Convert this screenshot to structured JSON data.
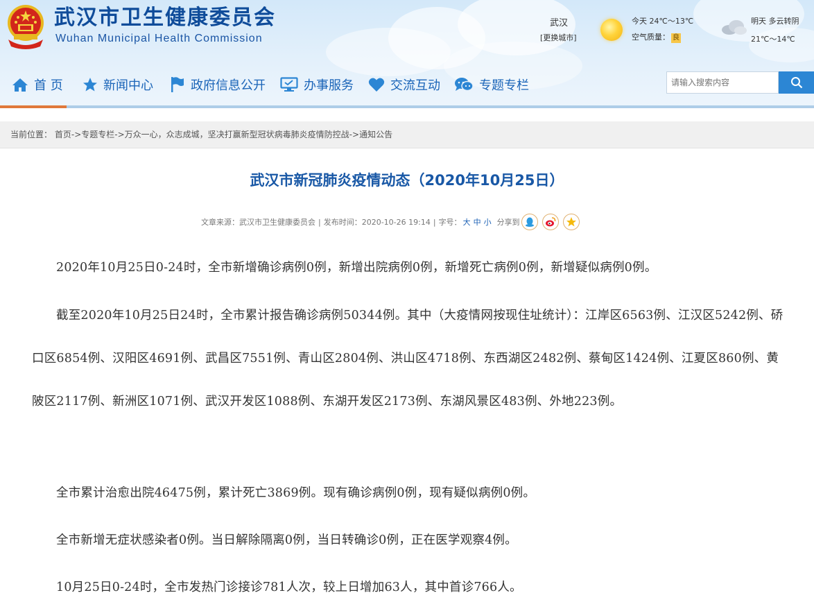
{
  "header": {
    "title_cn": "武汉市卫生健康委员会",
    "title_en": "Wuhan Municipal Health Commission"
  },
  "weather": {
    "city": "武汉",
    "change_city": "[更换城市]",
    "today": "今天 24℃～13℃",
    "aqi_label": "空气质量：",
    "aqi_value": "良",
    "tomorrow": "明天 多云转阴",
    "tomorrow_temp": "21℃～14℃",
    "icons": [
      "sun-icon",
      "cloudy-icon"
    ]
  },
  "nav": {
    "items": [
      {
        "label": "首 页",
        "icon": "home-icon"
      },
      {
        "label": "新闻中心",
        "icon": "star-icon"
      },
      {
        "label": "政府信息公开",
        "icon": "flag-icon"
      },
      {
        "label": "办事服务",
        "icon": "monitor-icon"
      },
      {
        "label": "交流互动",
        "icon": "heart-icon"
      },
      {
        "label": "专题专栏",
        "icon": "chat-icon"
      }
    ],
    "active_index": 0,
    "accent": "#e0783a"
  },
  "search": {
    "placeholder": "请输入搜索内容",
    "button_icon": "search-icon"
  },
  "breadcrumb": {
    "prefix": "当前位置：",
    "items": [
      "首页",
      "专题专栏",
      "万众一心，众志成城，坚决打赢新型冠状病毒肺炎疫情防控战",
      "通知公告"
    ],
    "separator": "->"
  },
  "article": {
    "title": "武汉市新冠肺炎疫情动态（2020年10月25日）",
    "source_label": "文章来源：",
    "source": "武汉市卫生健康委员会",
    "date_label": "发布时间：",
    "date": "2020-10-26 19:14",
    "fontsize_label": "字号：",
    "fontsize_large": "大",
    "fontsize_medium": "中",
    "fontsize_small": "小",
    "share_label": "分享到",
    "share_icons": [
      "qq-icon",
      "weibo-icon",
      "qzone-icon"
    ],
    "paragraphs": [
      "2020年10月25日0-24时，全市新增确诊病例0例，新增出院病例0例，新增死亡病例0例，新增疑似病例0例。",
      "截至2020年10月25日24时，全市累计报告确诊病例50344例。其中（大疫情网按现住址统计）：江岸区6563例、江汉区5242例、硚口区6854例、汉阳区4691例、武昌区7551例、青山区2804例、洪山区4718例、东西湖区2482例、蔡甸区1424例、江夏区860例、黄陂区2117例、新洲区1071例、武汉开发区1088例、东湖开发区2173例、东湖风景区483例、外地223例。",
      "全市累计治愈出院46475例，累计死亡3869例。现有确诊病例0例，现有疑似病例0例。",
      "全市新增无症状感染者0例。当日解除隔离0例，当日转确诊0例，正在医学观察4例。",
      "10月25日0-24时，全市发热门诊接诊781人次，较上日增加63人，其中首诊766人。"
    ]
  }
}
